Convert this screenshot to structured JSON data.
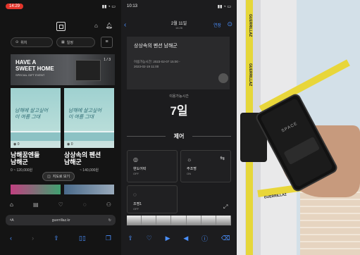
{
  "phone1": {
    "status_time": "14:29",
    "filters": {
      "region": "위치",
      "date": "일정"
    },
    "banner": {
      "title_line1": "HAVE A",
      "title_line2": "SWEET HOME",
      "subtitle": "SPECIAL GIFT EVENT",
      "counter": "1 / 3"
    },
    "cards": [
      {
        "image_text": "남해에 살고싶어\n이 여름 그대",
        "count": "0",
        "title": "남해꿈엔들",
        "region": "남해군",
        "price": "0 ~ 120,000원"
      },
      {
        "image_text": "남해에 살고싶어\n이 여름 그대",
        "count": "0",
        "title": "상상속의 펜션",
        "region": "남해군",
        "price": "~ 140,000원"
      }
    ],
    "map_button": "지도로 보기",
    "url": "guerrillaz.kr"
  },
  "phone2": {
    "status_time": "10:13",
    "header_date": "2월 11일",
    "header_time": "14:26",
    "header_action": "연장",
    "place_title": "상상속의 펜션 남해군",
    "period_label": "이용가능시간: 2023-02-07 15:00 -",
    "period_end": "2023-02-19 11:00",
    "remaining_label": "이용가능시간",
    "remaining_value": "7일",
    "section_title": "제어",
    "controls": [
      {
        "label": "현도어락",
        "sub": "OFF",
        "icon": "lock-icon"
      },
      {
        "label": "주조명",
        "sub": "ON",
        "icon": "slider-icon"
      },
      {
        "label": "조명1",
        "sub": "OFF",
        "icon": "bulb-icon"
      }
    ]
  },
  "photo": {
    "tape_text": "GUERRILLAZ",
    "phone_brand": "SPACE"
  }
}
